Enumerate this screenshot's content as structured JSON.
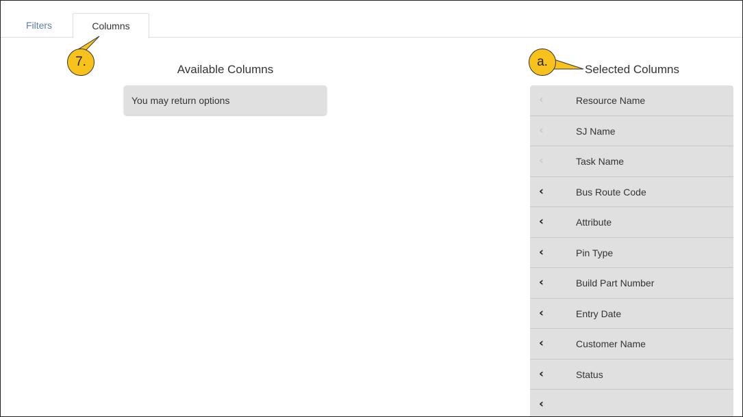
{
  "tabs": [
    {
      "label": "Filters"
    },
    {
      "label": "Columns"
    }
  ],
  "callouts": {
    "step": "7.",
    "sub": "a."
  },
  "available": {
    "title": "Available Columns",
    "empty_text": "You may return options"
  },
  "selected": {
    "title": "Selected Columns",
    "items": [
      {
        "label": "Resource Name",
        "movable": false
      },
      {
        "label": "SJ Name",
        "movable": false
      },
      {
        "label": "Task Name",
        "movable": false
      },
      {
        "label": "Bus Route Code",
        "movable": true
      },
      {
        "label": "Attribute",
        "movable": true
      },
      {
        "label": "Pin Type",
        "movable": true
      },
      {
        "label": "Build Part Number",
        "movable": true
      },
      {
        "label": "Entry Date",
        "movable": true
      },
      {
        "label": "Customer Name",
        "movable": true
      },
      {
        "label": "Status",
        "movable": true
      },
      {
        "label": "",
        "movable": true
      }
    ]
  },
  "colors": {
    "callout": "#f7c21b",
    "tab_inactive": "#5a7fa8",
    "row_bg": "#e0e0e0"
  },
  "icons": {
    "row_move": "chevron-left-icon"
  }
}
